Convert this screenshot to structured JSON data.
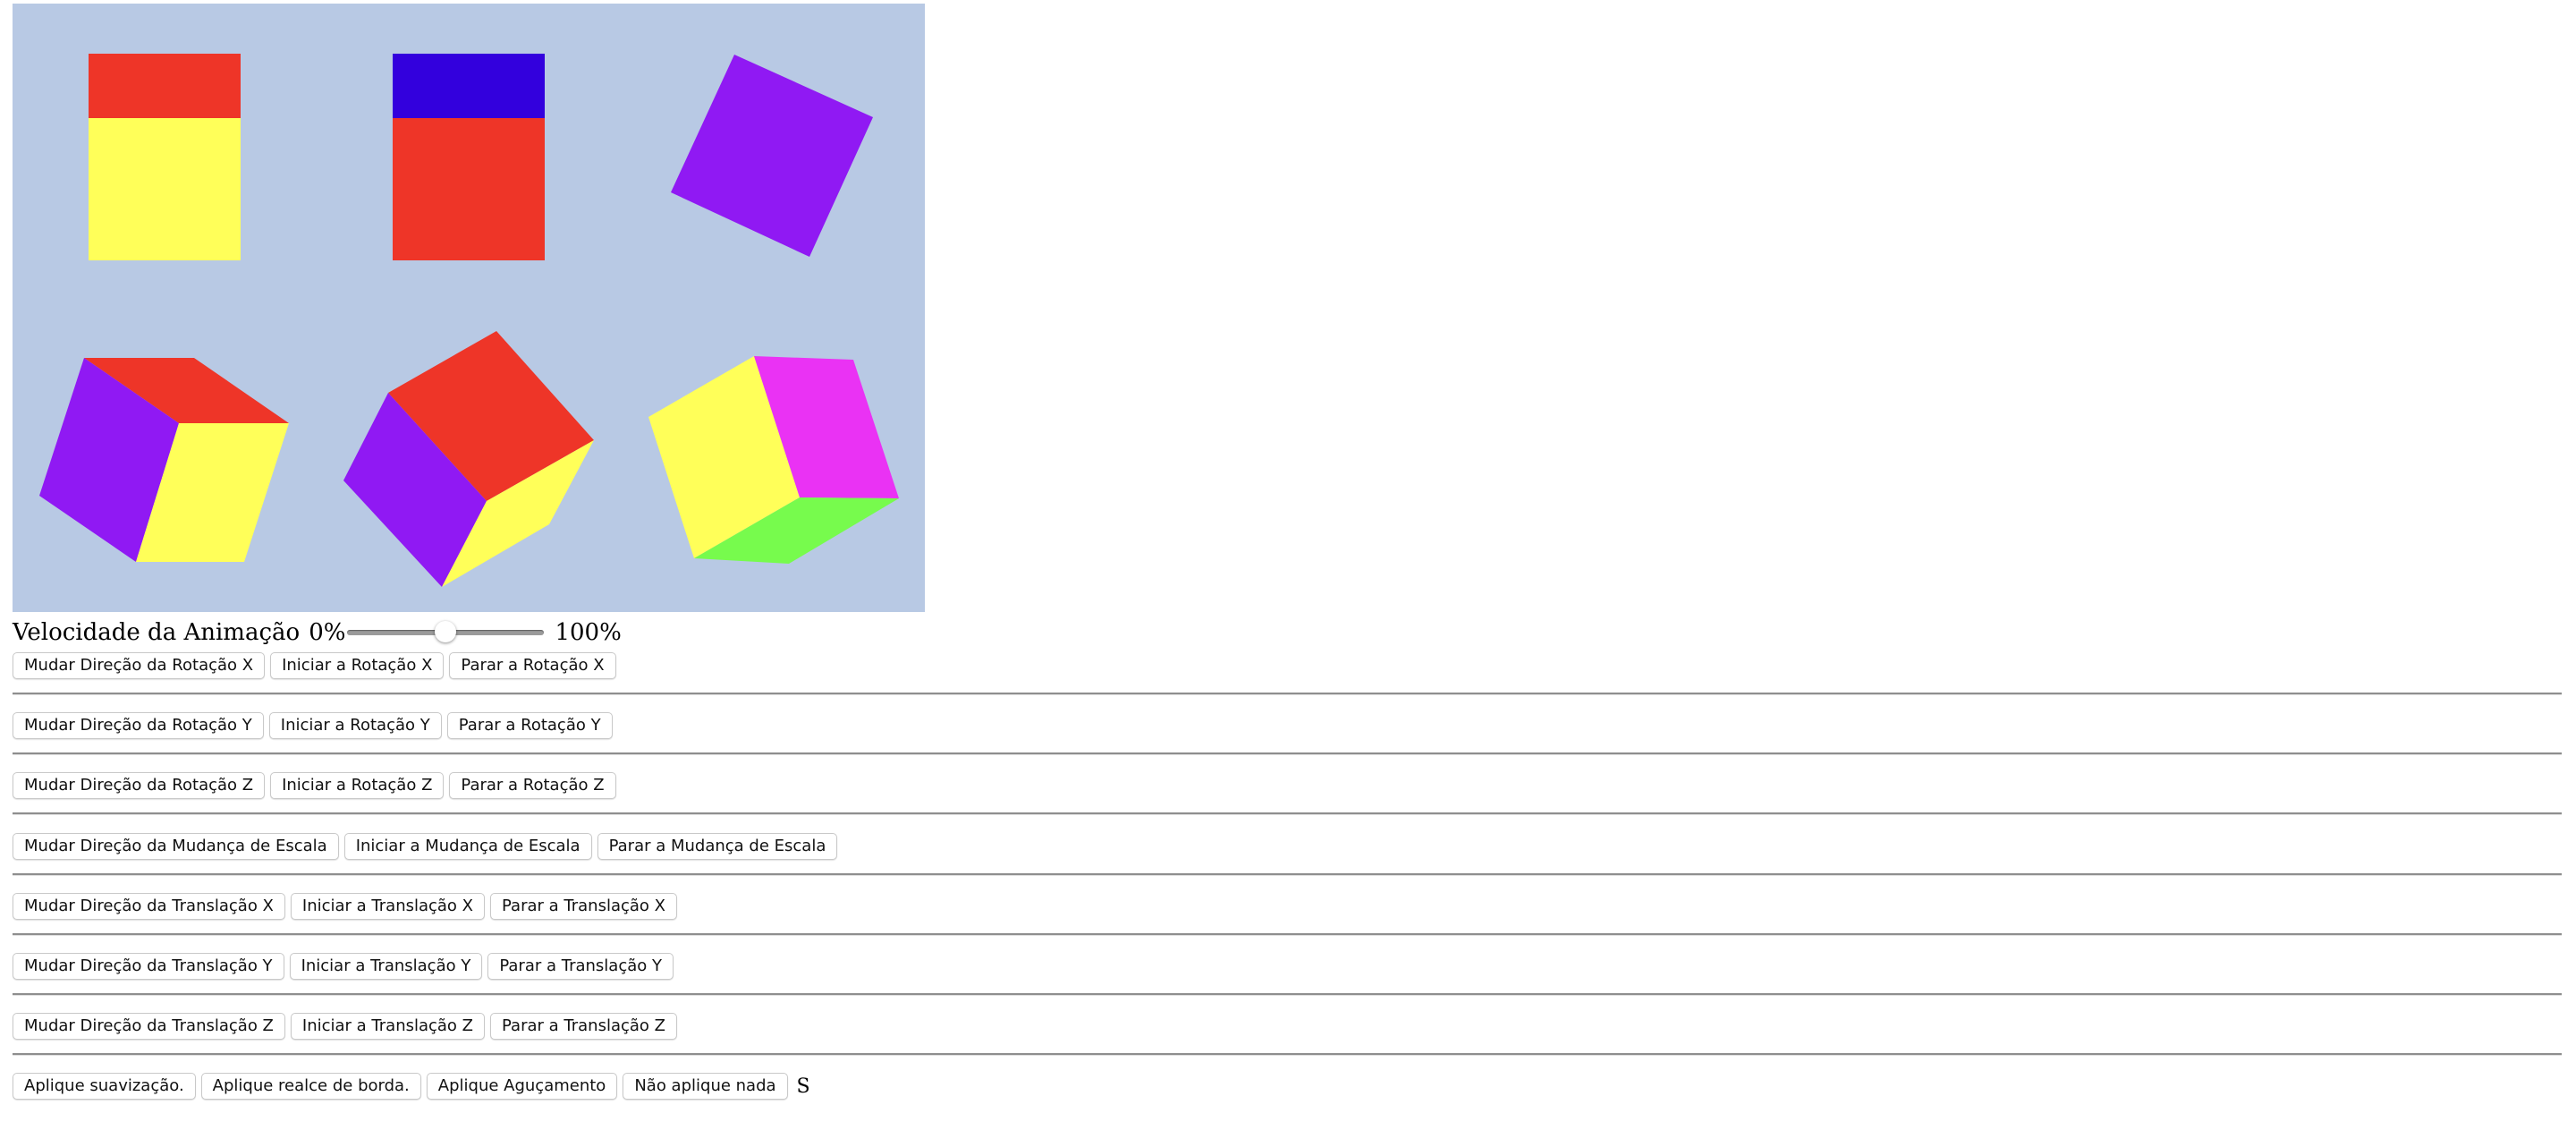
{
  "canvas": {
    "background": "#b8c9e4",
    "colors": {
      "red": "#ee3528",
      "yellow": "#ffff59",
      "blue": "#3300dd",
      "purple": "#9019f3",
      "magenta": "#ea32f4",
      "green": "#77fb4d"
    }
  },
  "speed": {
    "label": "Velocidade da Animação",
    "min_label": "0%",
    "max_label": "100%",
    "value_fraction": 0.5
  },
  "controls": {
    "rotation_x": {
      "change": "Mudar Direção da Rotação X",
      "start": "Iniciar a Rotação X",
      "stop": "Parar a Rotação X"
    },
    "rotation_y": {
      "change": "Mudar Direção da Rotação Y",
      "start": "Iniciar a Rotação Y",
      "stop": "Parar a Rotação Y"
    },
    "rotation_z": {
      "change": "Mudar Direção da Rotação Z",
      "start": "Iniciar a Rotação Z",
      "stop": "Parar a Rotação Z"
    },
    "scale": {
      "change": "Mudar Direção da Mudança de Escala",
      "start": "Iniciar a Mudança de Escala",
      "stop": "Parar a Mudança de Escala"
    },
    "translation_x": {
      "change": "Mudar Direção da Translação X",
      "start": "Iniciar a Translação X",
      "stop": "Parar a Translação X"
    },
    "translation_y": {
      "change": "Mudar Direção da Translação Y",
      "start": "Iniciar a Translação Y",
      "stop": "Parar a Translação Y"
    },
    "translation_z": {
      "change": "Mudar Direção da Translação Z",
      "start": "Iniciar a Translação Z",
      "stop": "Parar a Translação Z"
    }
  },
  "filters": {
    "smooth": "Aplique suavização.",
    "edge": "Aplique realce de borda.",
    "sharpen": "Aplique Aguçamento",
    "none": "Não aplique nada",
    "suffix": "S"
  }
}
